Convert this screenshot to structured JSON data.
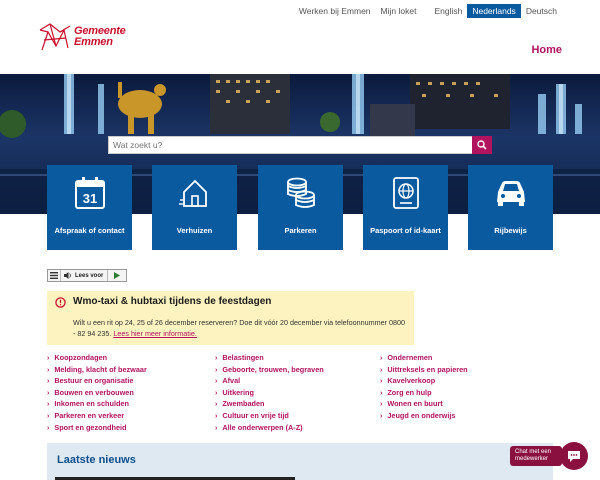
{
  "topnav": {
    "werken": "Werken bij Emmen",
    "loket": "Mijn loket",
    "english": "English",
    "nederlands": "Nederlands",
    "deutsch": "Deutsch"
  },
  "logo": {
    "line1": "Gemeente",
    "line2": "Emmen"
  },
  "home": "Home",
  "search": {
    "placeholder": "Wat zoekt u?"
  },
  "tiles": [
    {
      "label": "Afspraak of contact",
      "icon": "calendar-icon",
      "day": "31"
    },
    {
      "label": "Verhuizen",
      "icon": "house-icon"
    },
    {
      "label": "Parkeren",
      "icon": "coins-icon"
    },
    {
      "label": "Paspoort of id-kaart",
      "icon": "passport-icon"
    },
    {
      "label": "Rijbewijs",
      "icon": "car-icon"
    }
  ],
  "reader": {
    "label": "Lees voor"
  },
  "alert": {
    "title": "Wmo-taxi & hubtaxi tijdens de feestdagen",
    "body": "Wilt u een rit op 24, 25 of 26 december reserveren? Doe dit vóór 20 december via telefoonnummer 0800 - 82 94 235.",
    "link": "Lees hier meer informatie."
  },
  "links": {
    "col1": [
      "Koopzondagen",
      "Melding, klacht of bezwaar",
      "Bestuur en organisatie",
      "Bouwen en verbouwen",
      "Inkomen en schulden",
      "Parkeren en verkeer",
      "Sport en gezondheid"
    ],
    "col2": [
      "Belastingen",
      "Geboorte, trouwen, begraven",
      "Afval",
      "Uitkering",
      "Zwembaden",
      "Cultuur en vrije tijd",
      "Alle onderwerpen (A-Z)"
    ],
    "col3": [
      "Ondernemen",
      "Uittreksels en papieren",
      "Kavelverkoop",
      "Zorg en hulp",
      "Wonen en buurt",
      "Jeugd en onderwijs"
    ]
  },
  "news": {
    "title": "Laatste nieuws"
  },
  "chat": {
    "label": "Chat met een medewerker"
  },
  "colors": {
    "brand_blue": "#0a5aa0",
    "brand_magenta": "#b1135f",
    "logo_red": "#c8102e",
    "alert_bg": "#fdf3c0"
  }
}
